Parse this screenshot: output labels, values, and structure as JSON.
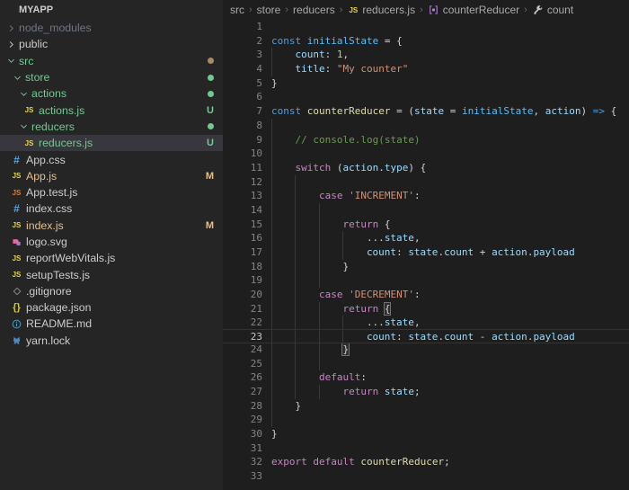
{
  "sidebar": {
    "header": {
      "title": "MYAPP"
    },
    "tree": [
      {
        "label": "node_modules",
        "chevron": "right",
        "depth": 0,
        "color": "dim",
        "icon": null,
        "badge": null,
        "selected": false
      },
      {
        "label": "public",
        "chevron": "right",
        "depth": 0,
        "color": "normal",
        "icon": null,
        "badge": null,
        "selected": false
      },
      {
        "label": "src",
        "chevron": "down",
        "depth": 0,
        "color": "green",
        "icon": null,
        "badge": "dot-gold",
        "selected": false
      },
      {
        "label": "store",
        "chevron": "down",
        "depth": 1,
        "color": "green",
        "icon": null,
        "badge": "dot-green",
        "selected": false
      },
      {
        "label": "actions",
        "chevron": "down",
        "depth": 2,
        "color": "green",
        "icon": null,
        "badge": "dot-green",
        "selected": false
      },
      {
        "label": "actions.js",
        "chevron": null,
        "depth": 2,
        "color": "green",
        "icon": "js",
        "badge": "U",
        "selected": false
      },
      {
        "label": "reducers",
        "chevron": "down",
        "depth": 2,
        "color": "green",
        "icon": null,
        "badge": "dot-green",
        "selected": false
      },
      {
        "label": "reducers.js",
        "chevron": null,
        "depth": 2,
        "color": "green",
        "icon": "js",
        "badge": "U",
        "selected": true
      },
      {
        "label": "App.css",
        "chevron": null,
        "depth": 0,
        "color": "normal",
        "icon": "hash",
        "badge": null,
        "selected": false
      },
      {
        "label": "App.js",
        "chevron": null,
        "depth": 0,
        "color": "gold",
        "icon": "js",
        "badge": "M",
        "selected": false
      },
      {
        "label": "App.test.js",
        "chevron": null,
        "depth": 0,
        "color": "normal",
        "icon": "jsOrange",
        "badge": null,
        "selected": false
      },
      {
        "label": "index.css",
        "chevron": null,
        "depth": 0,
        "color": "normal",
        "icon": "hash",
        "badge": null,
        "selected": false
      },
      {
        "label": "index.js",
        "chevron": null,
        "depth": 0,
        "color": "gold",
        "icon": "js",
        "badge": "M",
        "selected": false
      },
      {
        "label": "logo.svg",
        "chevron": null,
        "depth": 0,
        "color": "normal",
        "icon": "svgimg",
        "badge": null,
        "selected": false
      },
      {
        "label": "reportWebVitals.js",
        "chevron": null,
        "depth": 0,
        "color": "normal",
        "icon": "js",
        "badge": null,
        "selected": false
      },
      {
        "label": "setupTests.js",
        "chevron": null,
        "depth": 0,
        "color": "normal",
        "icon": "js",
        "badge": null,
        "selected": false
      },
      {
        "label": ".gitignore",
        "chevron": null,
        "depth": 0,
        "color": "normal",
        "icon": "git",
        "badge": null,
        "selected": false
      },
      {
        "label": "package.json",
        "chevron": null,
        "depth": 0,
        "color": "normal",
        "icon": "braces",
        "badge": null,
        "selected": false
      },
      {
        "label": "README.md",
        "chevron": null,
        "depth": 0,
        "color": "normal",
        "icon": "info",
        "badge": null,
        "selected": false
      },
      {
        "label": "yarn.lock",
        "chevron": null,
        "depth": 0,
        "color": "normal",
        "icon": "yarn",
        "badge": null,
        "selected": false
      }
    ]
  },
  "breadcrumb": {
    "items": [
      {
        "label": "src",
        "icon": null
      },
      {
        "label": "store",
        "icon": null
      },
      {
        "label": "reducers",
        "icon": null
      },
      {
        "label": "reducers.js",
        "icon": "js"
      },
      {
        "label": "counterReducer",
        "icon": "method"
      },
      {
        "label": "count",
        "icon": "wrench"
      }
    ]
  },
  "editor": {
    "language": "javascript",
    "active_line": 23,
    "lines": [
      {
        "n": 1,
        "g": 0,
        "active": false,
        "t": []
      },
      {
        "n": 2,
        "g": 0,
        "active": false,
        "t": [
          [
            "b",
            "const"
          ],
          [
            "p",
            " "
          ],
          [
            "cv",
            "initialState"
          ],
          [
            "p",
            " = {"
          ]
        ]
      },
      {
        "n": 3,
        "g": 1,
        "active": false,
        "t": [
          [
            "v",
            "count"
          ],
          [
            "p",
            ": "
          ],
          [
            "n",
            "1"
          ],
          [
            "p",
            ","
          ]
        ]
      },
      {
        "n": 4,
        "g": 1,
        "active": false,
        "t": [
          [
            "v",
            "title"
          ],
          [
            "p",
            ": "
          ],
          [
            "s",
            "\"My counter\""
          ]
        ]
      },
      {
        "n": 5,
        "g": 0,
        "active": false,
        "t": [
          [
            "p",
            "}"
          ]
        ]
      },
      {
        "n": 6,
        "g": 0,
        "active": false,
        "t": []
      },
      {
        "n": 7,
        "g": 0,
        "active": false,
        "t": [
          [
            "b",
            "const"
          ],
          [
            "p",
            " "
          ],
          [
            "fn",
            "counterReducer"
          ],
          [
            "p",
            " = ("
          ],
          [
            "v",
            "state"
          ],
          [
            "p",
            " = "
          ],
          [
            "cv",
            "initialState"
          ],
          [
            "p",
            ", "
          ],
          [
            "v",
            "action"
          ],
          [
            "p",
            ") "
          ],
          [
            "b",
            "=>"
          ],
          [
            "p",
            " {"
          ]
        ]
      },
      {
        "n": 8,
        "g": 1,
        "active": false,
        "t": []
      },
      {
        "n": 9,
        "g": 1,
        "active": false,
        "t": [
          [
            "c",
            "// console.log(state)"
          ]
        ]
      },
      {
        "n": 10,
        "g": 1,
        "active": false,
        "t": []
      },
      {
        "n": 11,
        "g": 1,
        "active": false,
        "t": [
          [
            "k",
            "switch"
          ],
          [
            "p",
            " ("
          ],
          [
            "v",
            "action"
          ],
          [
            "p",
            "."
          ],
          [
            "v",
            "type"
          ],
          [
            "p",
            ") {"
          ]
        ]
      },
      {
        "n": 12,
        "g": 2,
        "active": false,
        "t": []
      },
      {
        "n": 13,
        "g": 2,
        "active": false,
        "t": [
          [
            "k",
            "case"
          ],
          [
            "p",
            " "
          ],
          [
            "s",
            "'INCREMENT'"
          ],
          [
            "p",
            ":"
          ]
        ]
      },
      {
        "n": 14,
        "g": 3,
        "active": false,
        "t": []
      },
      {
        "n": 15,
        "g": 3,
        "active": false,
        "t": [
          [
            "k",
            "return"
          ],
          [
            "p",
            " {"
          ]
        ]
      },
      {
        "n": 16,
        "g": 4,
        "active": false,
        "t": [
          [
            "p",
            "..."
          ],
          [
            "v",
            "state"
          ],
          [
            "p",
            ","
          ]
        ]
      },
      {
        "n": 17,
        "g": 4,
        "active": false,
        "t": [
          [
            "v",
            "count"
          ],
          [
            "p",
            ": "
          ],
          [
            "v",
            "state"
          ],
          [
            "p",
            "."
          ],
          [
            "v",
            "count"
          ],
          [
            "p",
            " + "
          ],
          [
            "v",
            "action"
          ],
          [
            "p",
            "."
          ],
          [
            "v",
            "payload"
          ]
        ]
      },
      {
        "n": 18,
        "g": 3,
        "active": false,
        "t": [
          [
            "p",
            "}"
          ]
        ]
      },
      {
        "n": 19,
        "g": 3,
        "active": false,
        "t": []
      },
      {
        "n": 20,
        "g": 2,
        "active": false,
        "t": [
          [
            "k",
            "case"
          ],
          [
            "p",
            " "
          ],
          [
            "s",
            "'DECREMENT'"
          ],
          [
            "p",
            ":"
          ]
        ]
      },
      {
        "n": 21,
        "g": 3,
        "active": false,
        "t": [
          [
            "k",
            "return"
          ],
          [
            "p",
            " "
          ],
          [
            "pb",
            "{"
          ]
        ]
      },
      {
        "n": 22,
        "g": 4,
        "active": false,
        "t": [
          [
            "p",
            "..."
          ],
          [
            "v",
            "state"
          ],
          [
            "p",
            ","
          ]
        ]
      },
      {
        "n": 23,
        "g": 4,
        "active": true,
        "t": [
          [
            "v",
            "count"
          ],
          [
            "p",
            ": "
          ],
          [
            "v",
            "state"
          ],
          [
            "p",
            "."
          ],
          [
            "v",
            "count"
          ],
          [
            "p",
            " - "
          ],
          [
            "v",
            "action"
          ],
          [
            "p",
            "."
          ],
          [
            "v",
            "payload"
          ]
        ]
      },
      {
        "n": 24,
        "g": 3,
        "active": false,
        "t": [
          [
            "pb",
            "}"
          ]
        ]
      },
      {
        "n": 25,
        "g": 3,
        "active": false,
        "t": []
      },
      {
        "n": 26,
        "g": 2,
        "active": false,
        "t": [
          [
            "k",
            "default"
          ],
          [
            "p",
            ":"
          ]
        ]
      },
      {
        "n": 27,
        "g": 3,
        "active": false,
        "t": [
          [
            "k",
            "return"
          ],
          [
            "p",
            " "
          ],
          [
            "v",
            "state"
          ],
          [
            "p",
            ";"
          ]
        ]
      },
      {
        "n": 28,
        "g": 1,
        "active": false,
        "t": [
          [
            "p",
            "}"
          ]
        ]
      },
      {
        "n": 29,
        "g": 1,
        "active": false,
        "t": []
      },
      {
        "n": 30,
        "g": 0,
        "active": false,
        "t": [
          [
            "p",
            "}"
          ]
        ]
      },
      {
        "n": 31,
        "g": 0,
        "active": false,
        "t": []
      },
      {
        "n": 32,
        "g": 0,
        "active": false,
        "t": [
          [
            "k",
            "export"
          ],
          [
            "p",
            " "
          ],
          [
            "k",
            "default"
          ],
          [
            "p",
            " "
          ],
          [
            "fn",
            "counterReducer"
          ],
          [
            "p",
            ";"
          ]
        ]
      },
      {
        "n": 33,
        "g": 0,
        "active": false,
        "t": []
      }
    ]
  },
  "colors": {
    "editor_bg": "#1e1e1e",
    "sidebar_bg": "#252526",
    "selection_bg": "#37373d",
    "git_untracked_green": "#73C991",
    "git_modified_gold": "#E2C08D",
    "keyword_purple": "#C586C0",
    "storage_blue": "#569CD6",
    "variable_blue": "#9CDCFE",
    "const_blue": "#4FC1FF",
    "function_khaki": "#DCDCAA",
    "string_orange": "#CE9178",
    "number_green": "#B5CEA8",
    "comment_green": "#6A9955",
    "line_number": "#858585"
  }
}
